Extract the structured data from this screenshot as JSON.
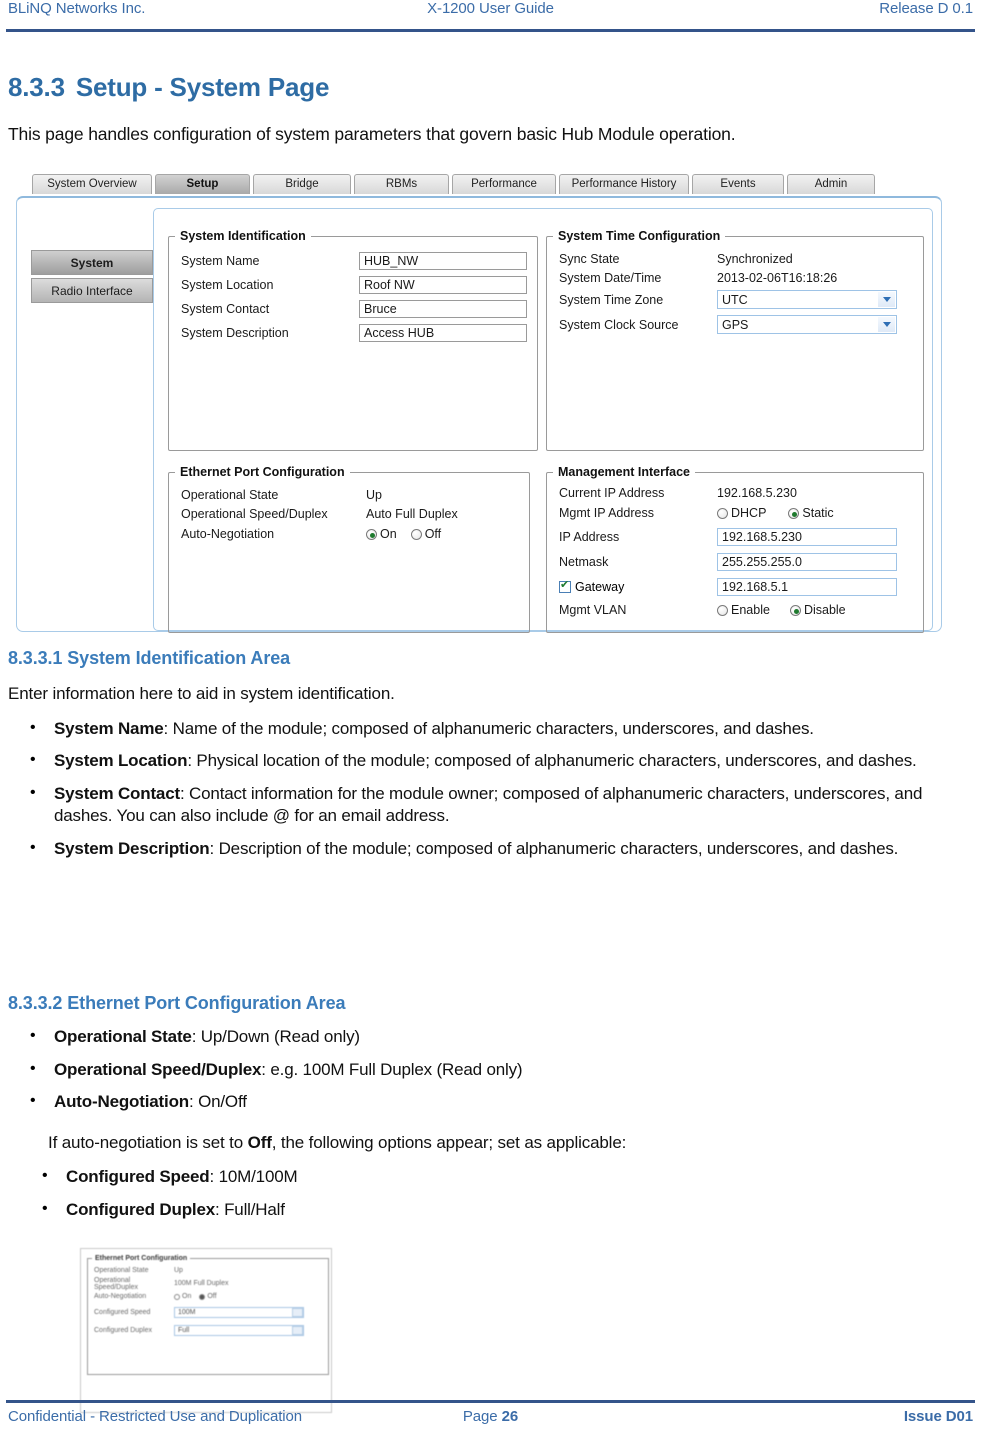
{
  "header": {
    "left": "BLiNQ Networks Inc.",
    "center": "X-1200 User Guide",
    "right": "Release D 0.1",
    "rule_color": "#34548a"
  },
  "accent_color": "#2e6ca4",
  "section": {
    "number": "8.3.3",
    "title": "Setup - System Page",
    "intro": "This page handles configuration of system parameters that govern basic Hub Module operation."
  },
  "screenshot": {
    "tabs": [
      {
        "label": "System Overview",
        "active": false
      },
      {
        "label": "Setup",
        "active": true
      },
      {
        "label": "Bridge",
        "active": false
      },
      {
        "label": "RBMs",
        "active": false
      },
      {
        "label": "Performance",
        "active": false
      },
      {
        "label": "Performance History",
        "active": false
      },
      {
        "label": "Events",
        "active": false
      },
      {
        "label": "Admin",
        "active": false
      }
    ],
    "sidebar": [
      {
        "label": "System",
        "active": true
      },
      {
        "label": "Radio Interface",
        "active": false
      }
    ],
    "system_identification": {
      "legend": "System Identification",
      "fields": [
        {
          "label": "System Name",
          "value": "HUB_NW"
        },
        {
          "label": "System Location",
          "value": "Roof NW"
        },
        {
          "label": "System Contact",
          "value": "Bruce"
        },
        {
          "label": "System Description",
          "value": "Access HUB"
        }
      ]
    },
    "system_time": {
      "legend": "System Time Configuration",
      "sync_state_label": "Sync State",
      "sync_state_value": "Synchronized",
      "datetime_label": "System Date/Time",
      "datetime_value": "2013-02-06T16:18:26",
      "timezone_label": "System Time Zone",
      "timezone_value": "UTC",
      "clocksource_label": "System Clock Source",
      "clocksource_value": "GPS"
    },
    "ethernet_port": {
      "legend": "Ethernet Port Configuration",
      "op_state_label": "Operational State",
      "op_state_value": "Up",
      "op_speed_label": "Operational Speed/Duplex",
      "op_speed_value": "Auto Full Duplex",
      "autoneg_label": "Auto-Negotiation",
      "autoneg_on": "On",
      "autoneg_off": "Off",
      "autoneg_selected": "On"
    },
    "management_interface": {
      "legend": "Management Interface",
      "current_ip_label": "Current IP Address",
      "current_ip_value": "192.168.5.230",
      "mgmt_ip_label": "Mgmt IP Address",
      "mgmt_ip_dhcp": "DHCP",
      "mgmt_ip_static": "Static",
      "mgmt_ip_selected": "Static",
      "ip_label": "IP Address",
      "ip_value": "192.168.5.230",
      "netmask_label": "Netmask",
      "netmask_value": "255.255.255.0",
      "gateway_label": "Gateway",
      "gateway_checked": true,
      "gateway_value": "192.168.5.1",
      "vlan_label": "Mgmt VLAN",
      "vlan_enable": "Enable",
      "vlan_disable": "Disable",
      "vlan_selected": "Disable"
    }
  },
  "sub1": {
    "number": "8.3.3.1",
    "title": "System Identification Area",
    "lead": "Enter information here to aid in system identification.",
    "bullets": [
      {
        "term": "System Name",
        "rest": ": Name of the module; composed of alphanumeric characters, underscores, and dashes."
      },
      {
        "term": "System Location",
        "rest": ": Physical location of the module; composed of alphanumeric characters, underscores, and dashes."
      },
      {
        "term": "System Contact",
        "rest": ": Contact information for the module owner; composed of alphanumeric characters, underscores, and dashes. You can also include @ for an email address."
      },
      {
        "term": "System Description",
        "rest": ": Description of the module; composed of alphanumeric characters, underscores, and dashes."
      }
    ]
  },
  "sub2": {
    "number": "8.3.3.2",
    "title": "Ethernet Port Configuration Area",
    "bullets": [
      {
        "term": "Operational State",
        "rest": ": Up/Down (Read only)"
      },
      {
        "term": "Operational Speed/Duplex",
        "rest": ": e.g. 100M Full Duplex (Read only)"
      },
      {
        "term": "Auto-Negotiation",
        "rest": ": On/Off"
      }
    ],
    "note_pre": "If auto-negotiation is set to ",
    "note_bold": "Off",
    "note_post": ", the following options appear; set as applicable:",
    "bullets2": [
      {
        "term": "Configured Speed",
        "rest": ": 10M/100M"
      },
      {
        "term": "Configured Duplex",
        "rest": ": Full/Half"
      }
    ]
  },
  "screenshot2": {
    "legend": "Ethernet Port Configuration",
    "op_state_label": "Operational State",
    "op_state_value": "Up",
    "op_speed_label": "Operational Speed/Duplex",
    "op_speed_value": "100M Full Duplex",
    "autoneg_label": "Auto-Negotiation",
    "autoneg_on": "On",
    "autoneg_off": "Off",
    "cfg_speed_label": "Configured Speed",
    "cfg_speed_value": "100M",
    "cfg_duplex_label": "Configured Duplex",
    "cfg_duplex_value": "Full"
  },
  "footer": {
    "left": "Confidential - Restricted Use and Duplication",
    "center_label": "Page ",
    "center_value": "26",
    "right": "Issue D01"
  }
}
